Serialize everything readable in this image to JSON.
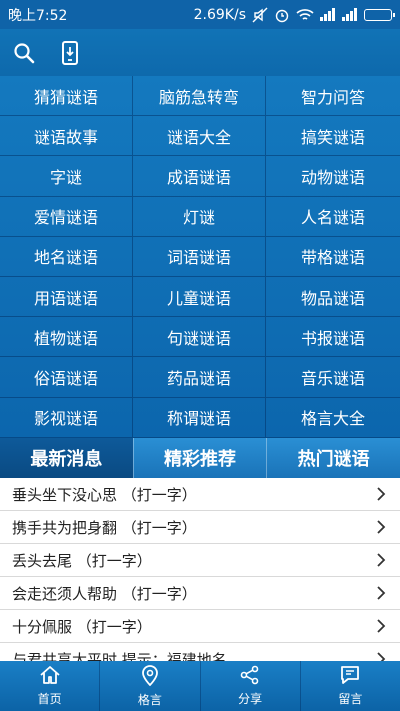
{
  "status_bar": {
    "time": "晚上7:52",
    "speed": "2.69K/s"
  },
  "toolbar": {
    "icons": [
      "search-icon",
      "phone-download-icon"
    ]
  },
  "grid": {
    "items": [
      "猜猜谜语",
      "脑筋急转弯",
      "智力问答",
      "谜语故事",
      "谜语大全",
      "搞笑谜语",
      "字谜",
      "成语谜语",
      "动物谜语",
      "爱情谜语",
      "灯谜",
      "人名谜语",
      "地名谜语",
      "词语谜语",
      "带格谜语",
      "用语谜语",
      "儿童谜语",
      "物品谜语",
      "植物谜语",
      "句谜谜语",
      "书报谜语",
      "俗语谜语",
      "药品谜语",
      "音乐谜语",
      "影视谜语",
      "称谓谜语",
      "格言大全"
    ]
  },
  "tabs": [
    {
      "label": "最新消息",
      "active": true
    },
    {
      "label": "精彩推荐",
      "active": false
    },
    {
      "label": "热门谜语",
      "active": false
    }
  ],
  "list": {
    "items": [
      "垂头坐下没心思 （打一字）",
      "携手共为把身翻 （打一字）",
      "丢头去尾 （打一字）",
      "会走还须人帮助 （打一字）",
      "十分佩服 （打一字）",
      "与君共享太平时 提示：福建地名"
    ]
  },
  "bottom_nav": [
    {
      "label": "首页",
      "icon": "home-icon"
    },
    {
      "label": "格言",
      "icon": "location-pin-icon"
    },
    {
      "label": "分享",
      "icon": "share-icon"
    },
    {
      "label": "留言",
      "icon": "message-edit-icon"
    }
  ],
  "colors": {
    "primary": "#0f63a8",
    "grid_bg": "#1479bf",
    "tab_active": "#0a4a82",
    "tab_inactive": "#2a8fd4"
  }
}
